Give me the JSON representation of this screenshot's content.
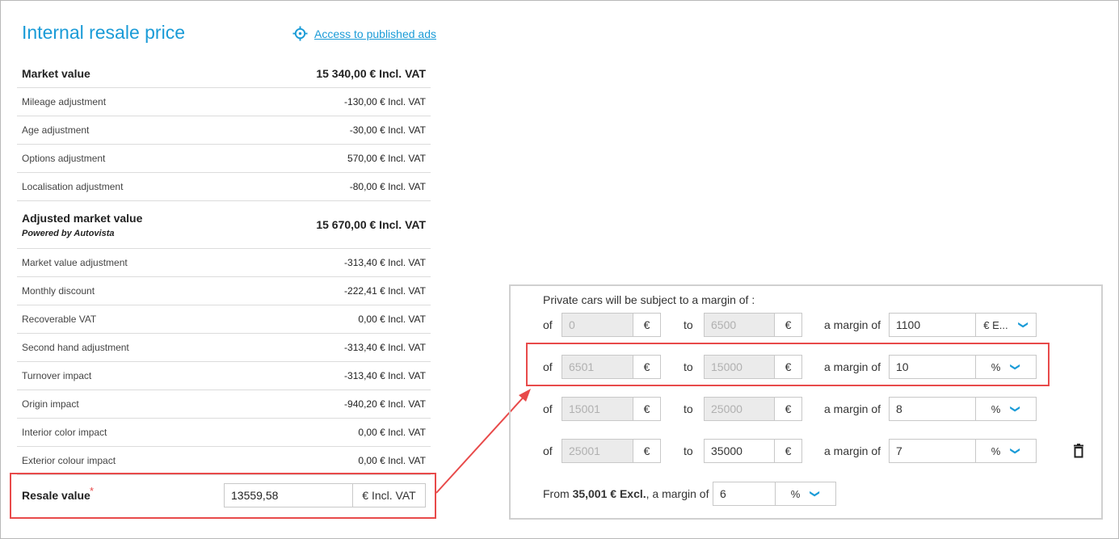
{
  "title": "Internal resale price",
  "access_link": "Access to published ads",
  "icons": {
    "access": "crosshair-icon",
    "dropdown": "chevron-down-icon",
    "delete": "trash-icon"
  },
  "accent_color": "#1a9bd7",
  "highlight_color": "#e84a4a",
  "market_value": {
    "label": "Market value",
    "value": "15 340,00 €  Incl. VAT"
  },
  "adjustments_1": [
    {
      "label": "Mileage adjustment",
      "value": "-130,00 € Incl. VAT"
    },
    {
      "label": "Age adjustment",
      "value": "-30,00 € Incl. VAT"
    },
    {
      "label": "Options adjustment",
      "value": "570,00 € Incl. VAT"
    },
    {
      "label": "Localisation adjustment",
      "value": "-80,00 € Incl. VAT"
    }
  ],
  "adjusted_market_value": {
    "label": "Adjusted market value",
    "sub": "Powered by Autovista",
    "value": "15 670,00 €  Incl. VAT"
  },
  "adjustments_2": [
    {
      "label": "Market value adjustment",
      "value": "-313,40 € Incl. VAT"
    },
    {
      "label": "Monthly discount",
      "value": "-222,41 € Incl. VAT"
    },
    {
      "label": "Recoverable VAT",
      "value": "0,00 € Incl. VAT"
    },
    {
      "label": "Second hand adjustment",
      "value": "-313,40 € Incl. VAT"
    },
    {
      "label": "Turnover impact",
      "value": "-313,40 € Incl. VAT"
    },
    {
      "label": "Origin impact",
      "value": "-940,20 € Incl. VAT"
    },
    {
      "label": "Interior color impact",
      "value": "0,00 € Incl. VAT"
    },
    {
      "label": "Exterior colour impact",
      "value": "0,00 € Incl. VAT"
    }
  ],
  "resale": {
    "label": "Resale value",
    "required": "*",
    "value": "13559,58",
    "unit": "€ Incl. VAT"
  },
  "margins": {
    "title": "Private cars will be subject to a margin of :",
    "of_label": "of",
    "to_label": "to",
    "margin_label": "a margin of",
    "currency": "€",
    "rows": [
      {
        "from": "0",
        "to": "6500",
        "margin": "1100",
        "unit": "€ E..."
      },
      {
        "from": "6501",
        "to": "15000",
        "margin": "10",
        "unit": "%"
      },
      {
        "from": "15001",
        "to": "25000",
        "margin": "8",
        "unit": "%"
      },
      {
        "from": "25001",
        "to": "35000",
        "margin": "7",
        "unit": "%"
      }
    ],
    "final": {
      "prefix": "From ",
      "amount": "35,001 € Excl.",
      "suffix": ", a margin of",
      "margin": "6",
      "unit": "%"
    }
  }
}
